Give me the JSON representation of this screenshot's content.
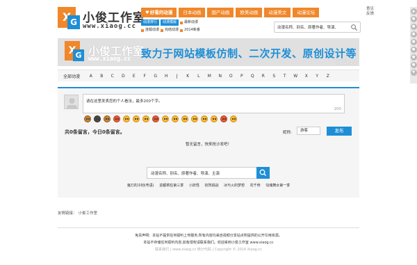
{
  "header": {
    "logo_name": "小俊工作室",
    "logo_url": "www.xiaog.cc",
    "nav": [
      "好看的动漫",
      "日本动画",
      "国产动画",
      "欧美动画",
      "动漫美文",
      "动漫论坛"
    ],
    "subnav": [
      {
        "label": "动漫排行",
        "tag": true
      },
      {
        "label": "动漫模版",
        "tag": true
      },
      {
        "label": "最新动漫",
        "tag": false
      },
      {
        "label": "连载动漫",
        "tag": false
      },
      {
        "label": "完结动漫",
        "tag": false
      },
      {
        "label": "2014新番",
        "tag": false
      }
    ],
    "search_placeholder": "动漫名称、别名、原著作者、导演、",
    "side_links": [
      "意见",
      "反馈"
    ],
    "colors": {
      "accent": "#f0872a",
      "blue": "#1e8ed6"
    }
  },
  "banner": {
    "name": "小俊工作室",
    "url": "www.xiaog.cc",
    "slogan": "致力于网站模板仿制、二次开发、原创设计等",
    "size": "960x90"
  },
  "letters": {
    "all": "全部动漫",
    "items": [
      "A",
      "B",
      "C",
      "D",
      "E",
      "F",
      "G",
      "H",
      "J",
      "K",
      "L",
      "M",
      "N",
      "O",
      "P",
      "Q",
      "R",
      "S",
      "T",
      "W",
      "X",
      "Y",
      "Z"
    ]
  },
  "comment": {
    "placeholder": "请在这里发表您的个人看法，最多200个字。",
    "counter": "200",
    "count_line": "共0条留言，今日0条留言。",
    "nick_label": "昵称:",
    "nickname": "游客",
    "publish": "发布",
    "empty_msg": "暂无留言，快来抢沙发吧！"
  },
  "lower_search": {
    "placeholder": "动漫名称、别名、原著作者、导演、主演",
    "hot": [
      "鬼灯的冷彻(粤语)",
      "进都疯狂第三季",
      "小妖怪",
      "初阵挑战",
      "冰与火的梦想",
      "花千骨",
      "勾魂舞女第一季"
    ]
  },
  "friends": {
    "label": "友情链接：",
    "links": [
      "小俊工作室"
    ]
  },
  "footer": {
    "lines": [
      "免责声明：本站不提供任何视听上传服务,所有内容均来自视频分享站点所提供的公开引用资源。",
      "本站不存储任何视听内容,如有侵权请联系我们。欢迎来到小俊工作室 www.xiaog.cc",
      "联系我们 | www.xiaog.cc 统计代码 | Copyright © 2014 Xiaog.cc"
    ]
  }
}
